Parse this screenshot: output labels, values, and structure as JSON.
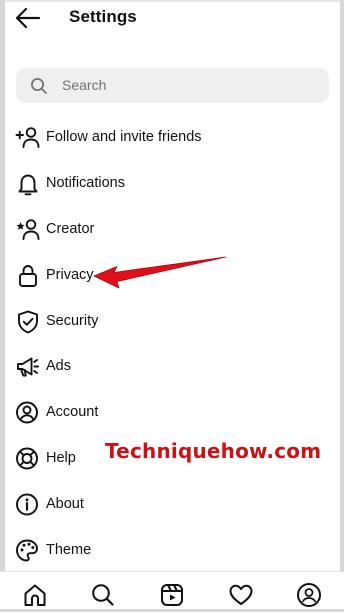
{
  "header": {
    "title": "Settings"
  },
  "search": {
    "placeholder": "Search"
  },
  "menu": [
    {
      "label": "Follow and invite friends",
      "icon": "add-person-icon"
    },
    {
      "label": "Notifications",
      "icon": "bell-icon"
    },
    {
      "label": "Creator",
      "icon": "creator-star-person-icon"
    },
    {
      "label": "Privacy",
      "icon": "lock-icon"
    },
    {
      "label": "Security",
      "icon": "shield-check-icon"
    },
    {
      "label": "Ads",
      "icon": "megaphone-icon"
    },
    {
      "label": "Account",
      "icon": "account-circle-icon"
    },
    {
      "label": "Help",
      "icon": "lifebuoy-icon"
    },
    {
      "label": "About",
      "icon": "info-icon"
    },
    {
      "label": "Theme",
      "icon": "palette-icon"
    }
  ],
  "annotation": {
    "watermark": "Techniquehow.com",
    "arrow_color": "#e0101a"
  },
  "bottom_nav": [
    "home-icon",
    "search-icon",
    "reels-icon",
    "heart-icon",
    "profile-icon"
  ],
  "colors": {
    "search_bg": "#efefef",
    "text": "#111111",
    "placeholder": "#737373",
    "watermark": "#d01010"
  }
}
